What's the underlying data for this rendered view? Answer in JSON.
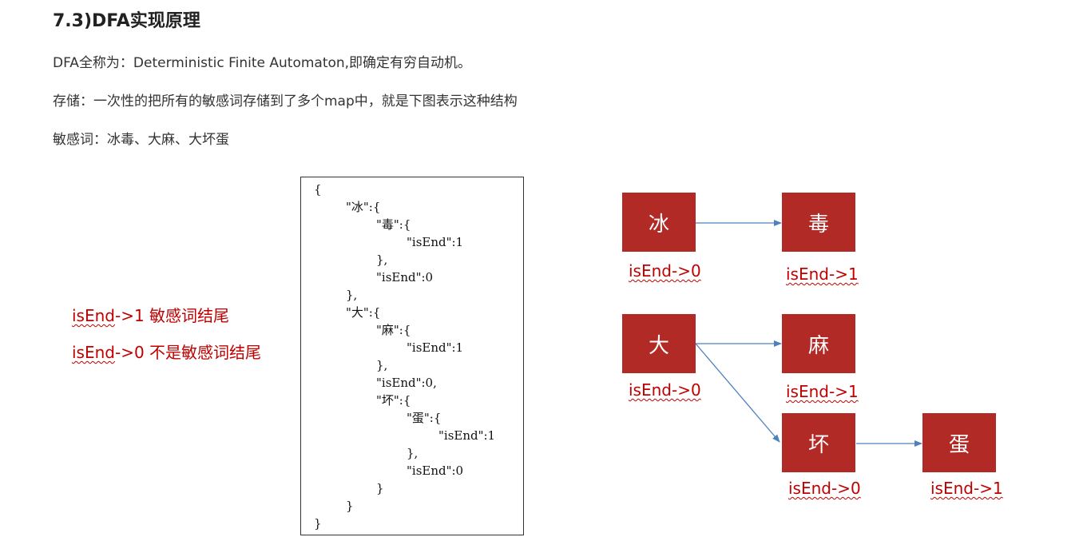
{
  "heading": "7.3)DFA实现原理",
  "paragraphs": [
    "DFA全称为：Deterministic Finite Automaton,即确定有穷自动机。",
    "存储：一次性的把所有的敏感词存储到了多个map中，就是下图表示这种结构",
    "敏感词：冰毒、大麻、大坏蛋"
  ],
  "legend": [
    {
      "keyword": "isEnd",
      "text": "->1 敏感词结尾"
    },
    {
      "keyword": "isEnd",
      "text": "->0 不是敏感词结尾"
    }
  ],
  "code_lines": [
    "{",
    "\"冰\":{",
    "\"毒\":{",
    "\"isEnd\":1",
    "},",
    "\"isEnd\":0",
    "},",
    "\"大\":{",
    "\"麻\":{",
    "\"isEnd\":1",
    "},",
    "\"isEnd\":0,",
    "\"坏\":{",
    "\"蛋\":{",
    "\"isEnd\":1",
    "},",
    "\"isEnd\":0",
    "}",
    "}",
    "}"
  ],
  "nodes": [
    {
      "char": "冰",
      "label": "isEnd->0"
    },
    {
      "char": "毒",
      "label": "isEnd->1"
    },
    {
      "char": "大",
      "label": "isEnd->0"
    },
    {
      "char": "麻",
      "label": "isEnd->1"
    },
    {
      "char": "坏",
      "label": "isEnd->0"
    },
    {
      "char": "蛋",
      "label": "isEnd->1"
    }
  ],
  "colors": {
    "node_fill": "#b22a26",
    "label_red": "#c00000",
    "arrow_blue": "#4f81bd"
  }
}
